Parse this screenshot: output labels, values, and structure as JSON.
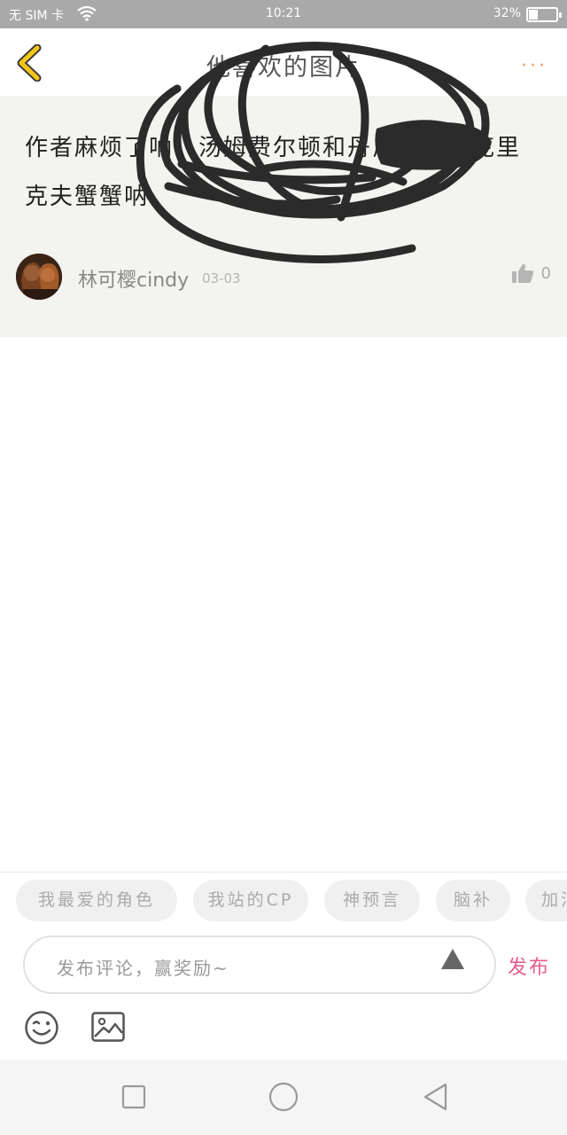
{
  "status_bar": {
    "carrier": "无 SIM 卡",
    "time": "10:21",
    "battery_text": "32%",
    "battery_level": 0.32
  },
  "header": {
    "title": "他喜欢的图片",
    "more_label": "···",
    "accent_color": "#f39c5b",
    "back_color": "#f5c518"
  },
  "comment": {
    "text": "作者麻烦了呐，汤姆费尔顿和丹尼尔雷德克里克夫蟹蟹呐",
    "user_name": "林可樱cindy",
    "date": "03-03",
    "like_count": "0"
  },
  "tags": [
    {
      "label": "我最爱的角色"
    },
    {
      "label": "我站的CP"
    },
    {
      "label": "神预言"
    },
    {
      "label": "脑补"
    },
    {
      "label": "加油"
    }
  ],
  "input": {
    "placeholder": "发布评论，赢奖励~"
  },
  "publish_label": "发布",
  "publish_color": "#e45c8e",
  "icons": [
    "back-chevron-icon",
    "more-dots-icon",
    "thumbs-up-icon",
    "emoji-icon",
    "image-icon",
    "send-triangle-icon",
    "nav-square-icon",
    "nav-circle-icon",
    "nav-back-icon"
  ]
}
